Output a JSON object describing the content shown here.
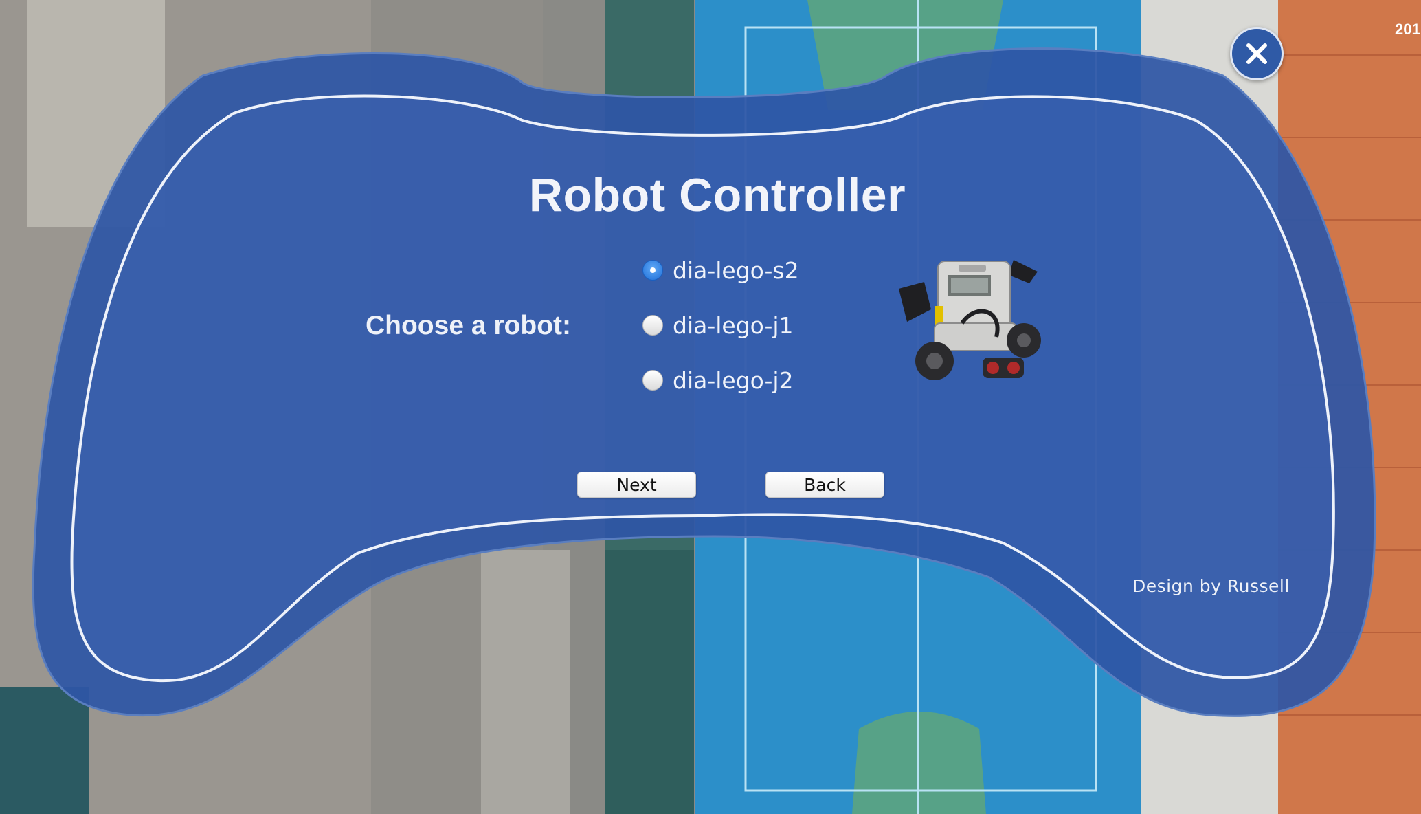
{
  "window": {
    "corner_text": "201"
  },
  "app": {
    "title": "Robot Controller",
    "choose_label": "Choose a robot:",
    "robots": [
      {
        "label": "dia-lego-s2",
        "selected": true
      },
      {
        "label": "dia-lego-j1",
        "selected": false
      },
      {
        "label": "dia-lego-j2",
        "selected": false
      }
    ],
    "next_label": "Next",
    "back_label": "Back",
    "credit": "Design by Russell",
    "close_icon": "close-icon",
    "robot_image_icon": "lego-robot-image"
  },
  "colors": {
    "panel_fill": "#2e56a6",
    "panel_inner": "#3c63b0",
    "court_blue": "#2c8fc9",
    "court_green": "#57a287",
    "roof_orange": "#d0774a",
    "radio_selected": "#1f6fd8"
  }
}
